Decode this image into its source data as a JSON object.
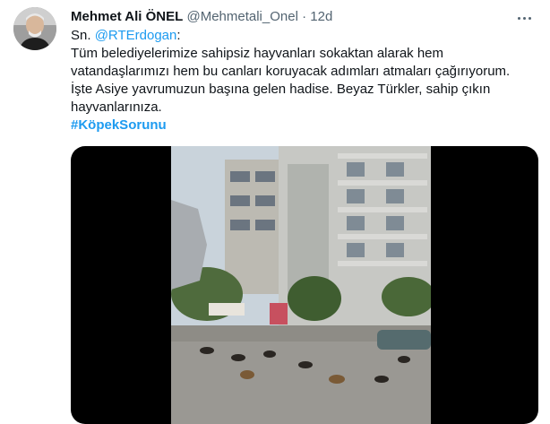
{
  "tweet": {
    "author_name": "Mehmet Ali ÖNEL",
    "handle": "@Mehmetali_Onel",
    "separator": "·",
    "time": "12d",
    "mention_prefix": "Sn. ",
    "mention": "@RTErdogan",
    "mention_suffix": ":",
    "text_lines": [
      "Tüm belediyelerimize sahipsiz hayvanları sokaktan alarak hem",
      "vatandaşlarımızı hem bu canları koruyacak adımları atmaları çağırıyorum.",
      "İşte Asiye yavrumuzun başına gelen hadise. Beyaz Türkler, sahip çıkın",
      "hayvanlarınıza."
    ],
    "hashtag": "#KöpekSorunu",
    "more_icon": "more-horizontal-icon"
  },
  "colors": {
    "accent": "#1d9bf0",
    "text": "#0f1419",
    "secondary": "#536471",
    "media_background": "#000000"
  }
}
